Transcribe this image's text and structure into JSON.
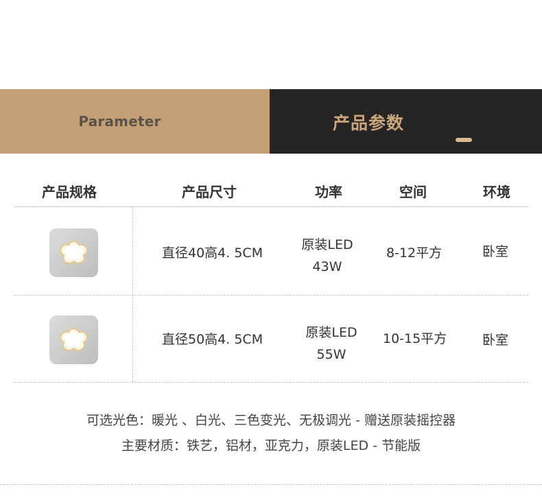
{
  "banner": {
    "left_label": "Parameter",
    "right_label": "产品参数",
    "colors": {
      "left_bg": "#c4a077",
      "right_bg": "#262424",
      "accent": "#c9a67b"
    }
  },
  "table": {
    "headers": [
      "产品规格",
      "产品尺寸",
      "功率",
      "空间",
      "环境"
    ],
    "rows": [
      {
        "image": "flower-ceiling-light",
        "size": "直径40高4. 5CM",
        "power_line1": "原装LED",
        "power_line2": "43W",
        "space": "8-12平方",
        "env": "卧室"
      },
      {
        "image": "flower-ceiling-light",
        "size": "直径50高4. 5CM",
        "power_line1": "原装LED",
        "power_line2": "55W",
        "space": "10-15平方",
        "env": "卧室"
      }
    ]
  },
  "notes": {
    "line1": "可选光色：暖光 、白光、三色变光、无极调光 - 赠送原装摇控器",
    "line2": "主要材质：铁艺，铝材，亚克力，原装LED - 节能版"
  }
}
